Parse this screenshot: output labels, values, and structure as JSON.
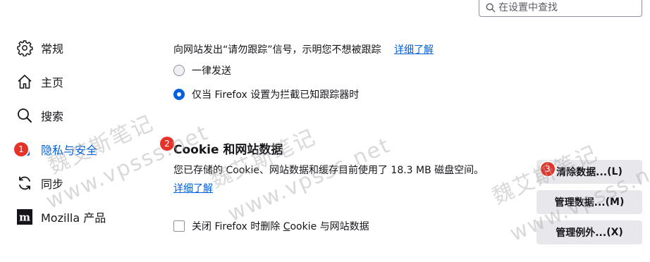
{
  "search": {
    "placeholder": "在设置中查找"
  },
  "sidebar": {
    "items": [
      {
        "label": "常规",
        "icon": "gear-icon"
      },
      {
        "label": "主页",
        "icon": "home-icon"
      },
      {
        "label": "搜索",
        "icon": "search-icon"
      },
      {
        "label": "隐私与安全",
        "icon": "lock-icon",
        "active": true,
        "badge": "1"
      },
      {
        "label": "同步",
        "icon": "sync-icon"
      },
      {
        "label": "Mozilla 产品",
        "icon": "mozilla-icon"
      }
    ]
  },
  "tracking": {
    "description": "向网站发出“请勿跟踪”信号，示明您不想被跟踪",
    "learn_more": "详细了解",
    "options": [
      {
        "label": "一律发送",
        "selected": false
      },
      {
        "label": "仅当 Firefox 设置为拦截已知跟踪器时",
        "selected": true
      }
    ]
  },
  "cookies": {
    "badge": "2",
    "title": "Cookie 和网站数据",
    "description": "您已存储的 Cookie、网站数据和缓存目前使用了 18.3 MB 磁盘空间。",
    "learn_more": "详细了解",
    "checkbox": {
      "prefix": "关闭 Firefox 时删除 ",
      "underlined": "C",
      "suffix": "ookie 与网站数据",
      "checked": false
    },
    "buttons": {
      "clear_badge": "3",
      "clear_label": "清除数据...",
      "clear_key": "(L)",
      "manage_label": "管理数据...",
      "manage_key": "(M)",
      "exceptions_label": "管理例外...",
      "exceptions_key": "(X)"
    }
  },
  "watermarks": [
    "魏艾斯笔记",
    "www.vpsss.net"
  ],
  "colors": {
    "accent": "#0061e0",
    "badge": "#e5332a",
    "button_bg": "#e8e8ec"
  }
}
